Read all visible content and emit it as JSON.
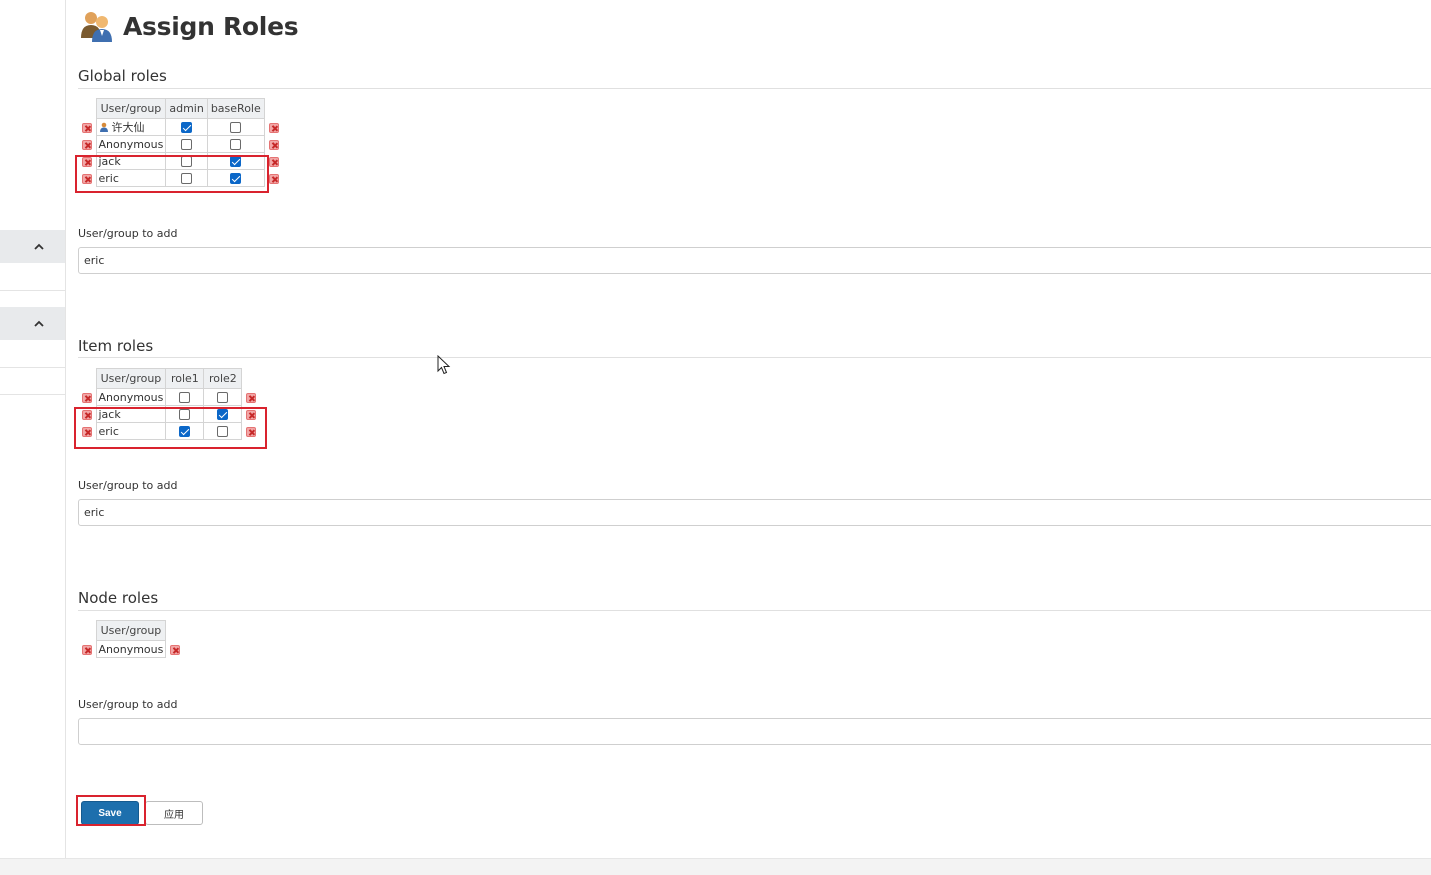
{
  "page": {
    "title": "Assign Roles"
  },
  "global_roles": {
    "title": "Global roles",
    "headers": [
      "User/group",
      "admin",
      "baseRole"
    ],
    "rows": [
      {
        "name": "许大仙",
        "user_icon": "user-icon",
        "admin": true,
        "baseRole": false
      },
      {
        "name": "Anonymous",
        "admin": false,
        "baseRole": false
      },
      {
        "name": "jack",
        "admin": false,
        "baseRole": true
      },
      {
        "name": "eric",
        "admin": false,
        "baseRole": true
      }
    ],
    "add_label": "User/group to add",
    "add_value": "eric"
  },
  "item_roles": {
    "title": "Item roles",
    "headers": [
      "User/group",
      "role1",
      "role2"
    ],
    "rows": [
      {
        "name": "Anonymous",
        "role1": false,
        "role2": false
      },
      {
        "name": "jack",
        "role1": false,
        "role2": true
      },
      {
        "name": "eric",
        "role1": true,
        "role2": false
      }
    ],
    "add_label": "User/group to add",
    "add_value": "eric"
  },
  "node_roles": {
    "title": "Node roles",
    "headers": [
      "User/group"
    ],
    "rows": [
      {
        "name": "Anonymous"
      }
    ],
    "add_label": "User/group to add",
    "add_value": ""
  },
  "buttons": {
    "save_label": "Save",
    "apply_label": "应用"
  },
  "colors": {
    "highlight": "#d9232e",
    "primary": "#1d6fad",
    "checked": "#0b67c8"
  }
}
